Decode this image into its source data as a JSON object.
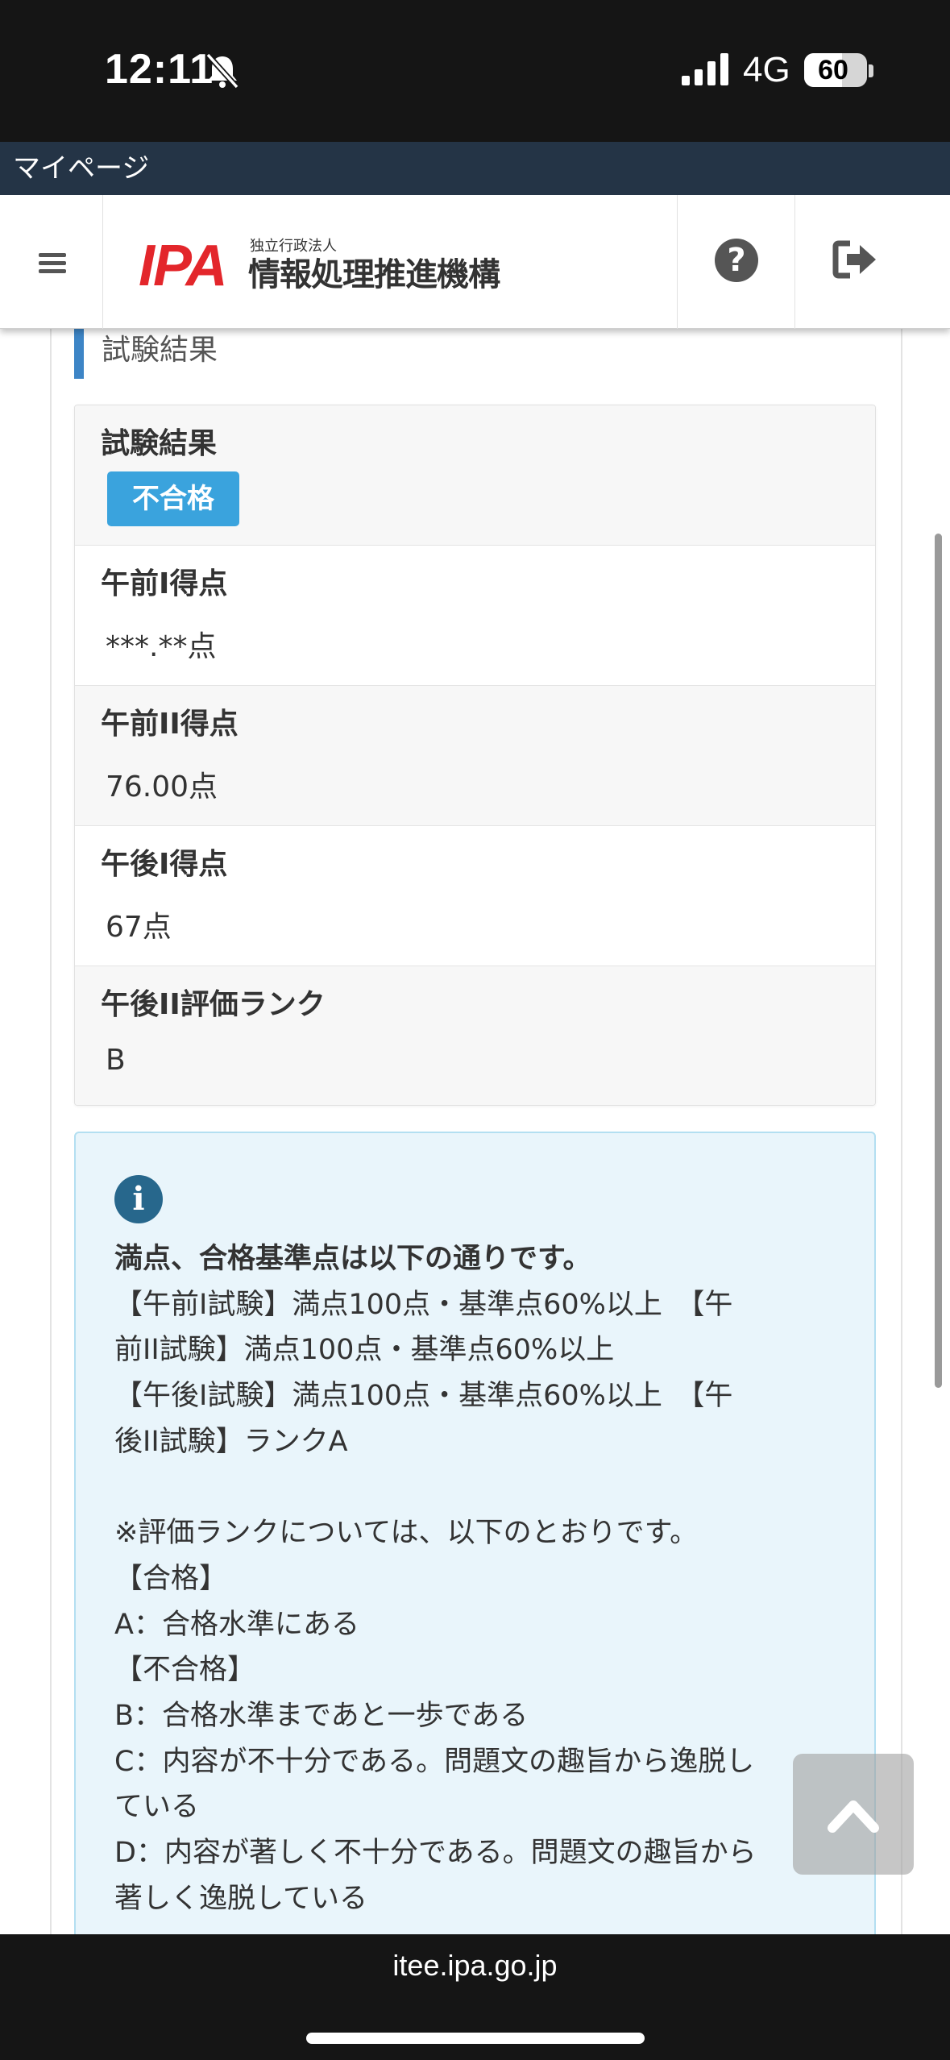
{
  "status_bar": {
    "time": "12:11",
    "network": "4G",
    "battery_level": "60",
    "battery_fraction": 0.6
  },
  "mypage_strip": {
    "label": "マイページ"
  },
  "header": {
    "logo_mark": "IPA",
    "logo_sub": "独立行政法人",
    "logo_main": "情報処理推進機構",
    "help_glyph": "?"
  },
  "section_title": "試験結果",
  "result": {
    "status_label": "試験結果",
    "status_badge": "不合格",
    "rows": [
      {
        "label": "午前I得点",
        "value": "***.**点"
      },
      {
        "label": "午前II得点",
        "value": "76.00点"
      },
      {
        "label": "午後I得点",
        "value": "67点"
      },
      {
        "label": "午後II評価ランク",
        "value": "B"
      }
    ]
  },
  "info": {
    "icon_glyph": "i",
    "lines": [
      "満点、合格基準点は以下の通りです。",
      "【午前I試験】満点100点・基準点60%以上　【午",
      "前II試験】満点100点・基準点60%以上",
      "【午後I試験】満点100点・基準点60%以上　【午",
      "後II試験】ランクA",
      "",
      "※評価ランクについては、以下のとおりです。",
      "【合格】",
      "A：合格水準にある",
      "【不合格】",
      "B：合格水準まであと一歩である",
      "C：内容が不十分である。問題文の趣旨から逸脱し",
      "ている",
      "D：内容が著しく不十分である。問題文の趣旨から",
      "著しく逸脱している"
    ]
  },
  "browser": {
    "url": "itee.ipa.go.jp"
  }
}
